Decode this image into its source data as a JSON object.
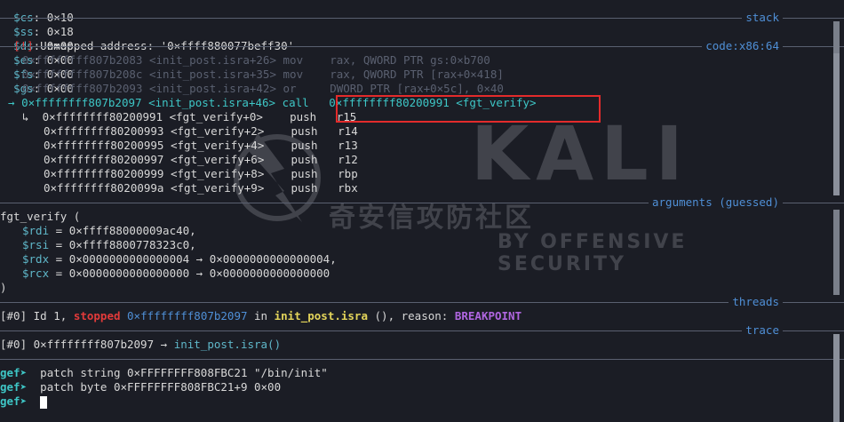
{
  "registers_line": {
    "items": [
      {
        "name": "$cs",
        "value": "0×10"
      },
      {
        "name": "$ss",
        "value": "0×18"
      },
      {
        "name": "$ds",
        "value": "0×00"
      },
      {
        "name": "$es",
        "value": "0×00"
      },
      {
        "name": "$fs",
        "value": "0×00"
      },
      {
        "name": "$gs",
        "value": "0×00"
      }
    ]
  },
  "sections": {
    "stack": "stack",
    "code": "code:x86:64",
    "arguments": "arguments (guessed)",
    "threads": "threads",
    "trace": "trace"
  },
  "unmapped": {
    "prefix": "[!]",
    "text": "Unmapped address: '0×ffff880077beff30'"
  },
  "code_lines": [
    {
      "marker": "",
      "addr": "0×ffffffff807b2083",
      "sym": "<init_post.isra+26>",
      "op": "mov",
      "args": "rax, QWORD PTR gs:0×b700",
      "dim": true
    },
    {
      "marker": "",
      "addr": "0×ffffffff807b208c",
      "sym": "<init_post.isra+35>",
      "op": "mov",
      "args": "rax, QWORD PTR [rax+0×418]",
      "dim": true
    },
    {
      "marker": "",
      "addr": "0×ffffffff807b2093",
      "sym": "<init_post.isra+42>",
      "op": "or",
      "args": "DWORD PTR [rax+0×5c], 0×40",
      "dim": true
    },
    {
      "marker": "→",
      "addr": "0×ffffffff807b2097",
      "sym": "<init_post.isra+46>",
      "op": "call",
      "args": "0×ffffffff80200991 <fgt_verify>",
      "dim": false,
      "current": true
    }
  ],
  "call_lines": [
    {
      "addr": "0×ffffffff80200991",
      "sym": "<fgt_verify+0>",
      "op": "push",
      "args": "r15",
      "arrow": "↳"
    },
    {
      "addr": "0×ffffffff80200993",
      "sym": "<fgt_verify+2>",
      "op": "push",
      "args": "r14",
      "arrow": ""
    },
    {
      "addr": "0×ffffffff80200995",
      "sym": "<fgt_verify+4>",
      "op": "push",
      "args": "r13",
      "arrow": ""
    },
    {
      "addr": "0×ffffffff80200997",
      "sym": "<fgt_verify+6>",
      "op": "push",
      "args": "r12",
      "arrow": ""
    },
    {
      "addr": "0×ffffffff80200999",
      "sym": "<fgt_verify+8>",
      "op": "push",
      "args": "rbp",
      "arrow": ""
    },
    {
      "addr": "0×ffffffff8020099a",
      "sym": "<fgt_verify+9>",
      "op": "push",
      "args": "rbx",
      "arrow": ""
    }
  ],
  "arguments": {
    "func": "fgt_verify (",
    "args": [
      {
        "reg": "$rdi",
        "value": "= 0×ffff88000009ac40,"
      },
      {
        "reg": "$rsi",
        "value": "= 0×ffff8800778323c0,"
      },
      {
        "reg": "$rdx",
        "value": "= 0×0000000000000004 → 0×0000000000000004,"
      },
      {
        "reg": "$rcx",
        "value": "= 0×0000000000000000 → 0×0000000000000000"
      }
    ],
    "close": ")"
  },
  "thread": {
    "id": "[#0]",
    "text": "Id 1,",
    "state": "stopped",
    "addr": "0×ffffffff807b2097",
    "in": "in",
    "func": "init_post.isra",
    "args": "(),",
    "reason_label": "reason:",
    "reason": "BREAKPOINT"
  },
  "trace_line": {
    "id": "[#0]",
    "addr": "0×ffffffff807b2097",
    "arrow": "→",
    "func": "init_post.isra()"
  },
  "prompt": {
    "label": "gef➤",
    "commands": [
      "patch string 0×FFFFFFFF808FBC21 \"/bin/init\"",
      "patch byte 0×FFFFFFFF808FBC21+9 0×00",
      ""
    ]
  },
  "watermark": {
    "cn": "奇安信攻防社区",
    "brand": "KALI",
    "tagline": "BY OFFENSIVE SECURITY"
  },
  "colors": {
    "bg": "#1b1d25",
    "accent": "#4f8fd6",
    "highlight": "#e32b2b"
  }
}
